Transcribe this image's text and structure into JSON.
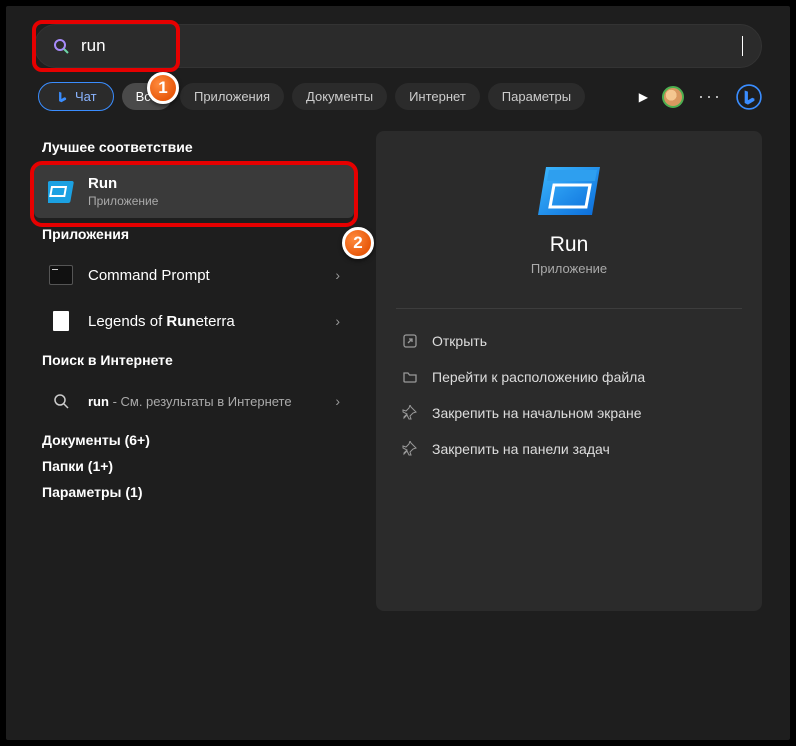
{
  "search": {
    "value": "run"
  },
  "chips": {
    "chat": "Чат",
    "all": "Все",
    "apps": "Приложения",
    "docs": "Документы",
    "internet": "Интернет",
    "settings": "Параметры"
  },
  "sections": {
    "best_match": "Лучшее соответствие",
    "applications": "Приложения",
    "web_search": "Поиск в Интернете",
    "documents": "Документы (6+)",
    "folders": "Папки (1+)",
    "parameters": "Параметры (1)"
  },
  "results": {
    "best": {
      "title": "Run",
      "subtitle": "Приложение"
    },
    "app1": "Command Prompt",
    "app2_pre": "Legends of ",
    "app2_bold": "Run",
    "app2_post": "eterra",
    "web_pre": "run",
    "web_post": " - См. результаты в Интернете"
  },
  "preview": {
    "title": "Run",
    "subtitle": "Приложение",
    "actions": {
      "open": "Открыть",
      "file_location": "Перейти к расположению файла",
      "pin_start": "Закрепить на начальном экране",
      "pin_taskbar": "Закрепить на панели задач"
    }
  },
  "badges": {
    "one": "1",
    "two": "2"
  }
}
